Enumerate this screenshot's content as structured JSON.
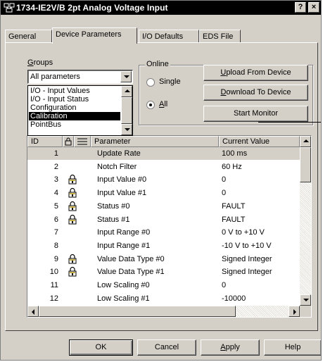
{
  "window": {
    "title": "1734-IE2V/B 2pt Analog Voltage Input",
    "help_button": "?",
    "close_button": "×"
  },
  "tabs": [
    {
      "label": "General",
      "active": false
    },
    {
      "label": "Device Parameters",
      "active": true
    },
    {
      "label": "I/O Defaults",
      "active": false
    },
    {
      "label": "EDS File",
      "active": false
    }
  ],
  "groups": {
    "label_accel": "G",
    "label_rest": "roups",
    "selected": "All parameters",
    "options": [
      {
        "label": "I/O - Input Values",
        "selected": false
      },
      {
        "label": "I/O - Input Status",
        "selected": false
      },
      {
        "label": "Configuration",
        "selected": false
      },
      {
        "label": "Calibration",
        "selected": true
      },
      {
        "label": "PointBus",
        "selected": false
      }
    ]
  },
  "online": {
    "legend": "Online",
    "single_label": "Single",
    "all_accel": "A",
    "all_rest": "ll",
    "selected": "All",
    "upload_accel": "U",
    "upload_rest": "pload From Device",
    "download_accel": "D",
    "download_rest": "ownload To Device",
    "start_monitor": "Start Monitor"
  },
  "grid": {
    "headers": {
      "id": "ID",
      "parameter": "Parameter",
      "value": "Current Value"
    },
    "rows": [
      {
        "id": "1",
        "locked": false,
        "parameter": "Update Rate",
        "value": "100 ms",
        "selected": true
      },
      {
        "id": "2",
        "locked": false,
        "parameter": "Notch Filter",
        "value": "60 Hz"
      },
      {
        "id": "3",
        "locked": true,
        "parameter": "Input Value #0",
        "value": "0"
      },
      {
        "id": "4",
        "locked": true,
        "parameter": "Input Value #1",
        "value": "0"
      },
      {
        "id": "5",
        "locked": true,
        "parameter": "Status #0",
        "value": "FAULT"
      },
      {
        "id": "6",
        "locked": true,
        "parameter": "Status #1",
        "value": "FAULT"
      },
      {
        "id": "7",
        "locked": false,
        "parameter": "Input Range #0",
        "value": "0 V to +10 V"
      },
      {
        "id": "8",
        "locked": false,
        "parameter": "Input Range #1",
        "value": "-10 V to +10 V"
      },
      {
        "id": "9",
        "locked": true,
        "parameter": "Value Data Type #0",
        "value": "Signed Integer"
      },
      {
        "id": "10",
        "locked": true,
        "parameter": "Value Data Type #1",
        "value": "Signed Integer"
      },
      {
        "id": "11",
        "locked": false,
        "parameter": "Low Scaling #0",
        "value": "0"
      },
      {
        "id": "12",
        "locked": false,
        "parameter": "Low Scaling #1",
        "value": "-10000"
      }
    ]
  },
  "buttons": {
    "ok": "OK",
    "cancel": "Cancel",
    "apply_accel": "A",
    "apply_rest": "pply",
    "help": "Help"
  },
  "colors": {
    "face": "#d4d0c8",
    "titlebar": "#000000",
    "selection": "#000000"
  }
}
